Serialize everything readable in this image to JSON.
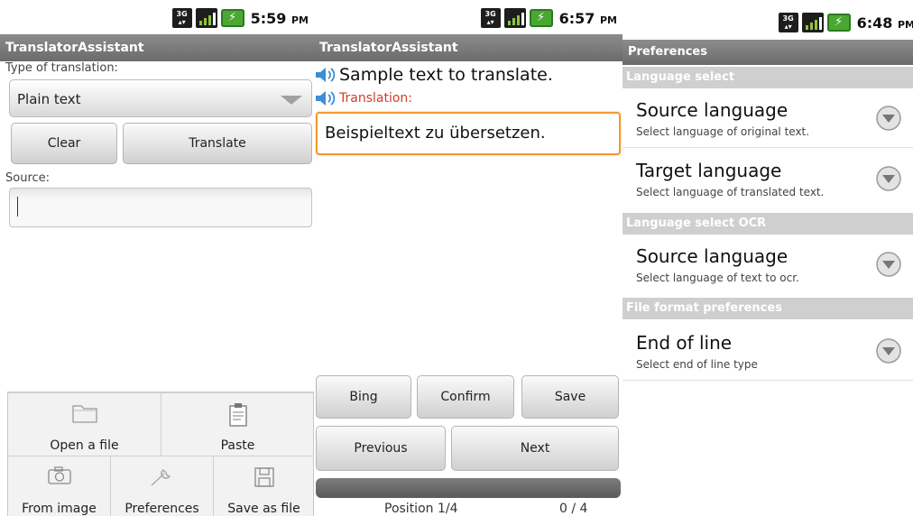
{
  "panel1": {
    "time": "5:59",
    "ampm": "PM",
    "app_title": "TranslatorAssistant",
    "type_label": "Type of translation:",
    "type_value": "Plain text",
    "clear_label": "Clear",
    "translate_label": "Translate",
    "source_label": "Source:",
    "source_value": "",
    "menu": {
      "open_file": "Open a file",
      "paste": "Paste",
      "from_image": "From image",
      "preferences": "Preferences",
      "save_as_file": "Save as file"
    }
  },
  "panel2": {
    "time": "6:57",
    "ampm": "PM",
    "app_title": "TranslatorAssistant",
    "sample_text": "Sample text to translate.",
    "translation_label": "Translation:",
    "translation_value": "Beispieltext zu übersetzen.",
    "bing_label": "Bing",
    "confirm_label": "Confirm",
    "save_label": "Save",
    "previous_label": "Previous",
    "next_label": "Next",
    "position_text": "Position 1/4",
    "count_text": "0 / 4"
  },
  "panel3": {
    "time": "6:48",
    "ampm": "PM",
    "title": "Preferences",
    "sections": [
      {
        "header": "Language select"
      },
      {
        "header": "Language select OCR"
      },
      {
        "header": "File format preferences"
      }
    ],
    "items": [
      {
        "title": "Source language",
        "summary": "Select language of original text."
      },
      {
        "title": "Target language",
        "summary": "Select language of translated text."
      },
      {
        "title": "Source language",
        "summary": "Select language of text to ocr."
      },
      {
        "title": "End of line",
        "summary": "Select end of line type"
      }
    ]
  },
  "status_icons": [
    "3g-icon",
    "signal-icon",
    "battery-charging-icon"
  ],
  "colors": {
    "title_bar": "#7b7b7b",
    "focus_border": "#f29a2e",
    "translation_label": "#d43a2a",
    "section_header": "#cfcfcf",
    "battery": "#4aa832"
  }
}
